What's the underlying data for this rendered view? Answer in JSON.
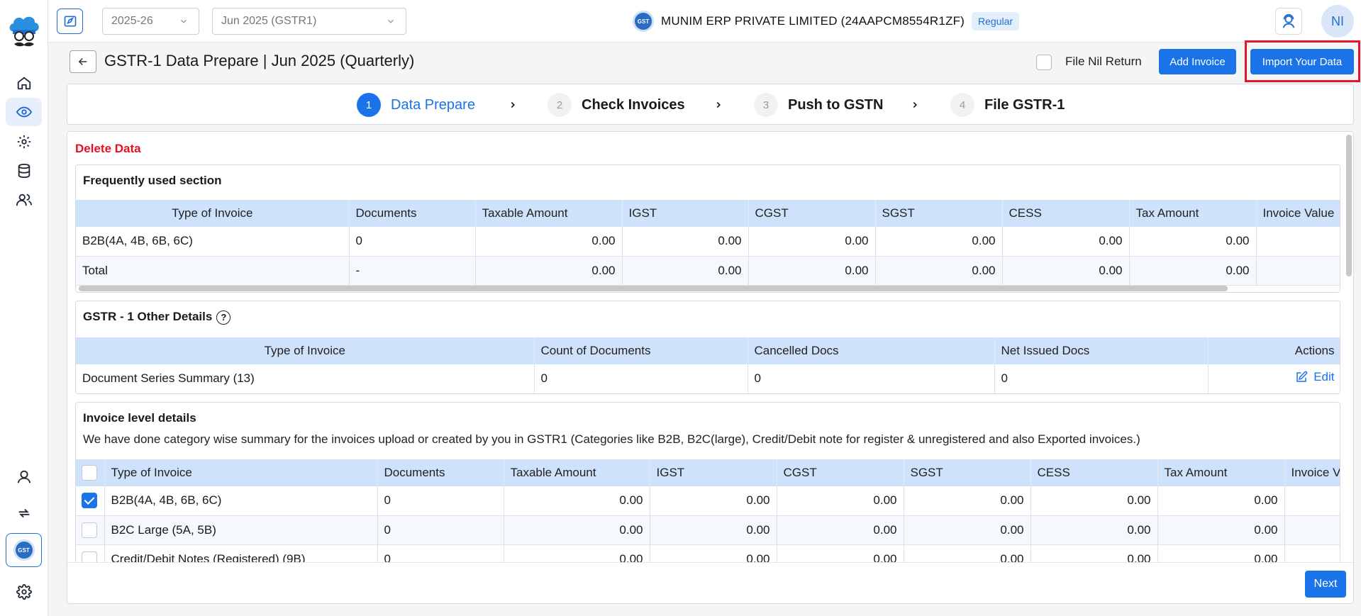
{
  "colors": {
    "primary": "#1a73e8",
    "danger": "#e8101f",
    "table_header": "#cfe2fb"
  },
  "topbar": {
    "year": "2025-26",
    "period": "Jun 2025 (GSTR1)",
    "company": "MUNIM ERP PRIVATE LIMITED (24AAPCM8554R1ZF)",
    "reg_type": "Regular",
    "gst_logo": "GST",
    "avatar_initials": "NI"
  },
  "header": {
    "title": "GSTR-1 Data Prepare | Jun 2025 (Quarterly)",
    "nil_return_label": "File Nil Return",
    "add_invoice_label": "Add Invoice",
    "import_label": "Import Your Data"
  },
  "steps": [
    {
      "num": "1",
      "label": "Data Prepare"
    },
    {
      "num": "2",
      "label": "Check Invoices"
    },
    {
      "num": "3",
      "label": "Push to GSTN"
    },
    {
      "num": "4",
      "label": "File GSTR-1"
    }
  ],
  "delete_label": "Delete Data",
  "frequent": {
    "title": "Frequently used section",
    "columns": [
      "Type of Invoice",
      "Documents",
      "Taxable Amount",
      "IGST",
      "CGST",
      "SGST",
      "CESS",
      "Tax Amount",
      "Invoice Value"
    ],
    "rows": [
      [
        "B2B(4A, 4B, 6B, 6C)",
        "0",
        "0.00",
        "0.00",
        "0.00",
        "0.00",
        "0.00",
        "0.00",
        ""
      ],
      [
        "Total",
        "-",
        "0.00",
        "0.00",
        "0.00",
        "0.00",
        "0.00",
        "0.00",
        ""
      ]
    ]
  },
  "other": {
    "title": "GSTR - 1 Other Details",
    "help": "?",
    "columns": [
      "Type of Invoice",
      "Count of Documents",
      "Cancelled Docs",
      "Net Issued Docs",
      "Actions"
    ],
    "row": [
      "Document Series Summary (13)",
      "0",
      "0",
      "0"
    ],
    "edit_label": "Edit"
  },
  "invoice_level": {
    "title": "Invoice level details",
    "subtitle": "We have done category wise summary for the invoices upload or created by you in GSTR1 (Categories like B2B, B2C(large), Credit/Debit note for register & unregistered and also Exported invoices.)",
    "columns": [
      "Type of Invoice",
      "Documents",
      "Taxable Amount",
      "IGST",
      "CGST",
      "SGST",
      "CESS",
      "Tax Amount",
      "Invoice V"
    ],
    "rows": [
      [
        "B2B(4A, 4B, 6B, 6C)",
        "0",
        "0.00",
        "0.00",
        "0.00",
        "0.00",
        "0.00",
        "0.00",
        ""
      ],
      [
        "B2C Large (5A, 5B)",
        "0",
        "0.00",
        "0.00",
        "0.00",
        "0.00",
        "0.00",
        "0.00",
        ""
      ],
      [
        "Credit/Debit Notes (Registered) (9B)",
        "0",
        "0.00",
        "0.00",
        "0.00",
        "0.00",
        "0.00",
        "0.00",
        ""
      ]
    ]
  },
  "next_label": "Next"
}
